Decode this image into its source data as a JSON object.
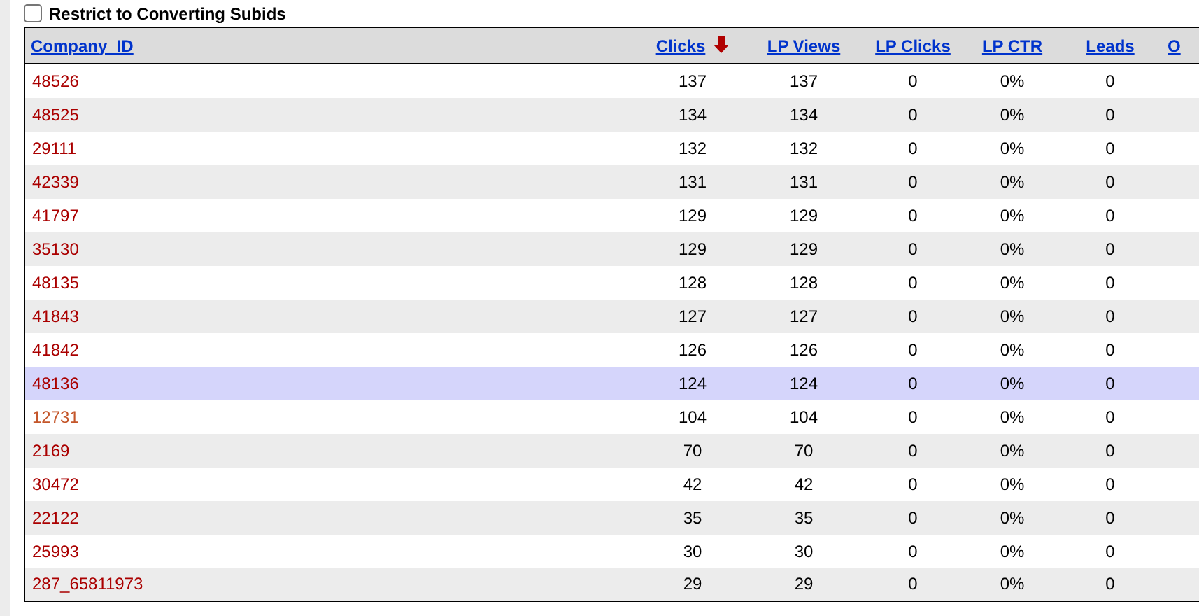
{
  "filter": {
    "label": "Restrict to Converting Subids",
    "checked": false
  },
  "table": {
    "columns": [
      {
        "label": "Company_ID",
        "sorted": false
      },
      {
        "label": "Clicks",
        "sorted": true
      },
      {
        "label": "LP Views",
        "sorted": false
      },
      {
        "label": "LP Clicks",
        "sorted": false
      },
      {
        "label": "LP CTR",
        "sorted": false
      },
      {
        "label": "Leads",
        "sorted": false
      },
      {
        "label": "O",
        "sorted": false
      }
    ],
    "rows": [
      {
        "cells": [
          "48526",
          "137",
          "137",
          "0",
          "0%",
          "0"
        ],
        "selected": false,
        "color": "#aa0000"
      },
      {
        "cells": [
          "48525",
          "134",
          "134",
          "0",
          "0%",
          "0"
        ],
        "selected": false,
        "color": "#aa0000"
      },
      {
        "cells": [
          "29111",
          "132",
          "132",
          "0",
          "0%",
          "0"
        ],
        "selected": false,
        "color": "#aa0000"
      },
      {
        "cells": [
          "42339",
          "131",
          "131",
          "0",
          "0%",
          "0"
        ],
        "selected": false,
        "color": "#aa0000"
      },
      {
        "cells": [
          "41797",
          "129",
          "129",
          "0",
          "0%",
          "0"
        ],
        "selected": false,
        "color": "#aa0000"
      },
      {
        "cells": [
          "35130",
          "129",
          "129",
          "0",
          "0%",
          "0"
        ],
        "selected": false,
        "color": "#aa0000"
      },
      {
        "cells": [
          "48135",
          "128",
          "128",
          "0",
          "0%",
          "0"
        ],
        "selected": false,
        "color": "#aa0000"
      },
      {
        "cells": [
          "41843",
          "127",
          "127",
          "0",
          "0%",
          "0"
        ],
        "selected": false,
        "color": "#aa0000"
      },
      {
        "cells": [
          "41842",
          "126",
          "126",
          "0",
          "0%",
          "0"
        ],
        "selected": false,
        "color": "#aa0000"
      },
      {
        "cells": [
          "48136",
          "124",
          "124",
          "0",
          "0%",
          "0"
        ],
        "selected": true,
        "color": "#aa0000"
      },
      {
        "cells": [
          "12731",
          "104",
          "104",
          "0",
          "0%",
          "0"
        ],
        "selected": false,
        "color": "#c4562a"
      },
      {
        "cells": [
          "2169",
          "70",
          "70",
          "0",
          "0%",
          "0"
        ],
        "selected": false,
        "color": "#aa0000"
      },
      {
        "cells": [
          "30472",
          "42",
          "42",
          "0",
          "0%",
          "0"
        ],
        "selected": false,
        "color": "#aa0000"
      },
      {
        "cells": [
          "22122",
          "35",
          "35",
          "0",
          "0%",
          "0"
        ],
        "selected": false,
        "color": "#aa0000"
      },
      {
        "cells": [
          "25993",
          "30",
          "30",
          "0",
          "0%",
          "0"
        ],
        "selected": false,
        "color": "#aa0000"
      },
      {
        "cells": [
          "287_65811973",
          "29",
          "29",
          "0",
          "0%",
          "0"
        ],
        "selected": false,
        "color": "#aa0000"
      }
    ]
  }
}
